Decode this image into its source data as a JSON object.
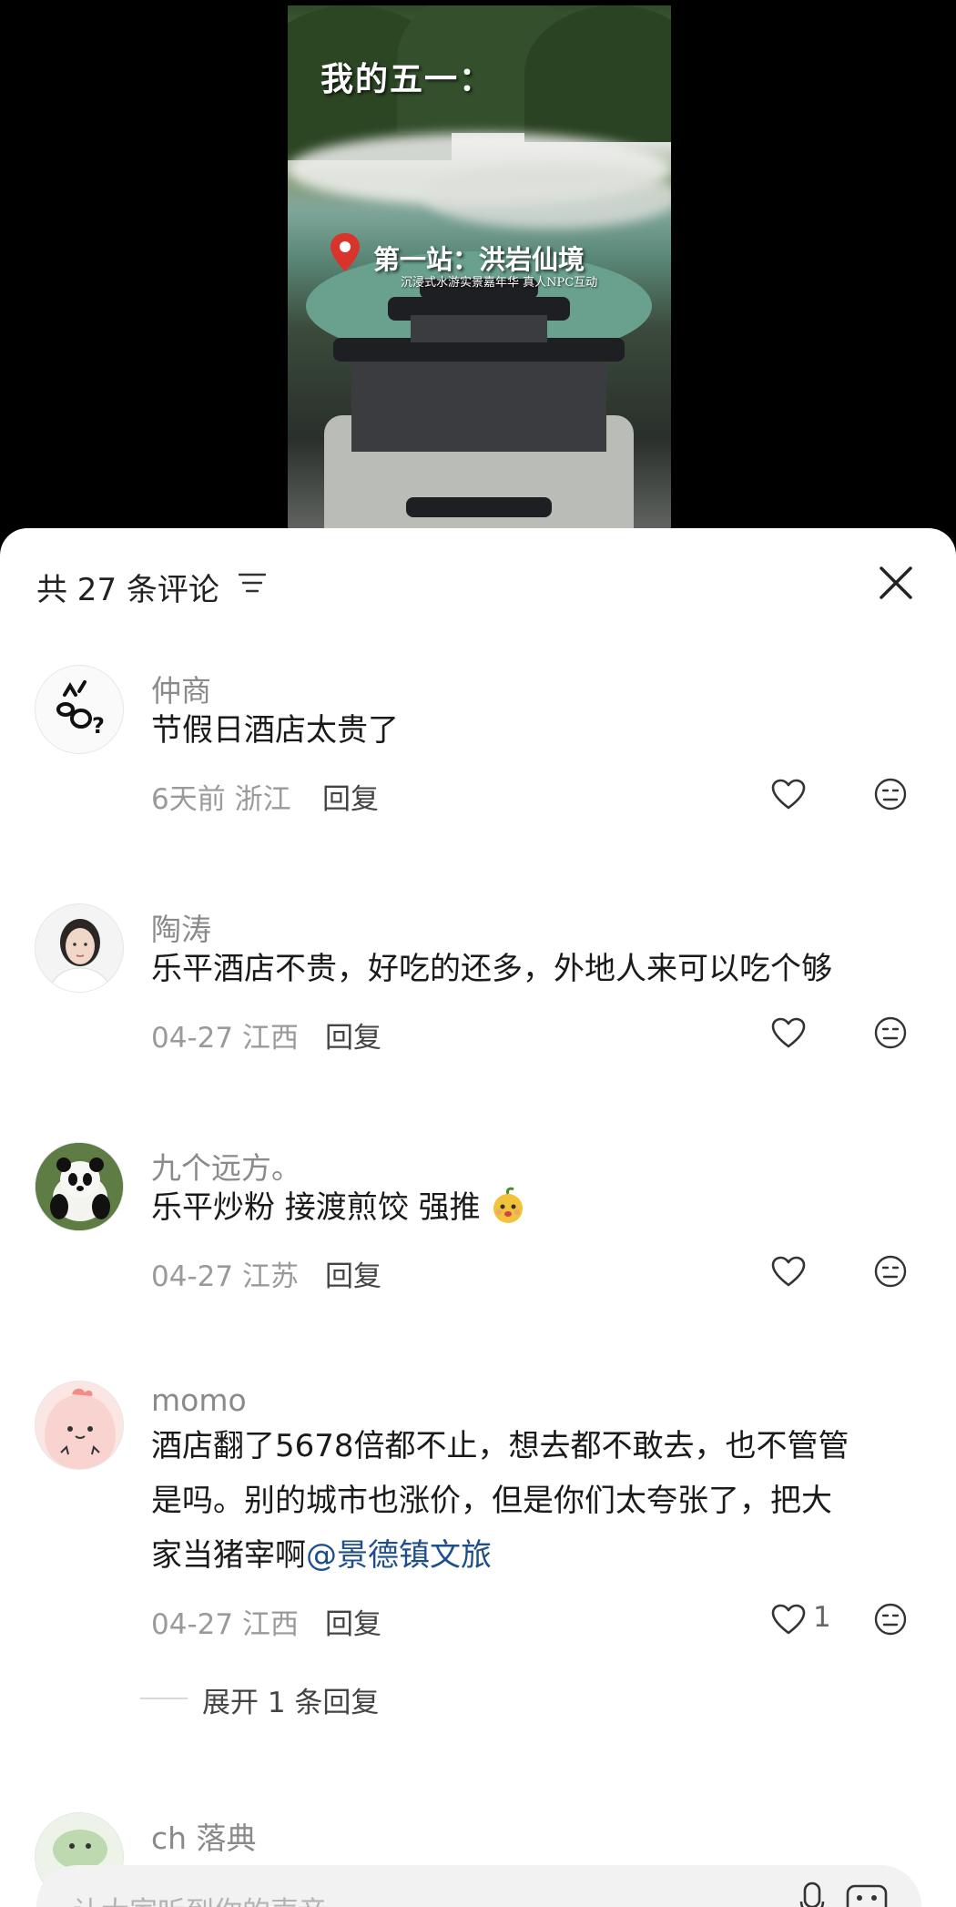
{
  "video": {
    "title": "我的五一：",
    "stop_title": "第一站：洪岩仙境",
    "stop_subtitle": "沉浸式水游实景嘉年华 真人NPC互动"
  },
  "sheet": {
    "count_label": "共 27 条评论",
    "sort_icon": "filter-lines-icon",
    "close_icon": "close-icon"
  },
  "comments": [
    {
      "name": "仲商",
      "text": "节假日酒店太贵了",
      "time": "6天前",
      "location": "浙江",
      "reply_label": "回复",
      "likes": ""
    },
    {
      "name": "陶涛",
      "text": "乐平酒店不贵，好吃的还多，外地人来可以吃个够",
      "time": "04-27",
      "location": "江西",
      "reply_label": "回复",
      "likes": ""
    },
    {
      "name": "九个远方。",
      "text": "乐平炒粉 接渡煎饺 强推",
      "time": "04-27",
      "location": "江苏",
      "reply_label": "回复",
      "likes": ""
    },
    {
      "name": "momo",
      "text_line1": "酒店翻了5678倍都不止，想去都不敢去，也不管管",
      "text_line2": "是吗。别的城市也涨价，但是你们太夸张了，把大",
      "text_line3": "家当猪宰啊",
      "mention": "@景德镇文旅",
      "time": "04-27",
      "location": "江西",
      "reply_label": "回复",
      "likes": "1",
      "expand_label": "展开 1 条回复"
    },
    {
      "name": "ch 落典"
    }
  ],
  "input": {
    "placeholder": "让大家听到你的声音"
  },
  "colors": {
    "mention": "#1f4e8c",
    "pin": "#d9342b"
  }
}
